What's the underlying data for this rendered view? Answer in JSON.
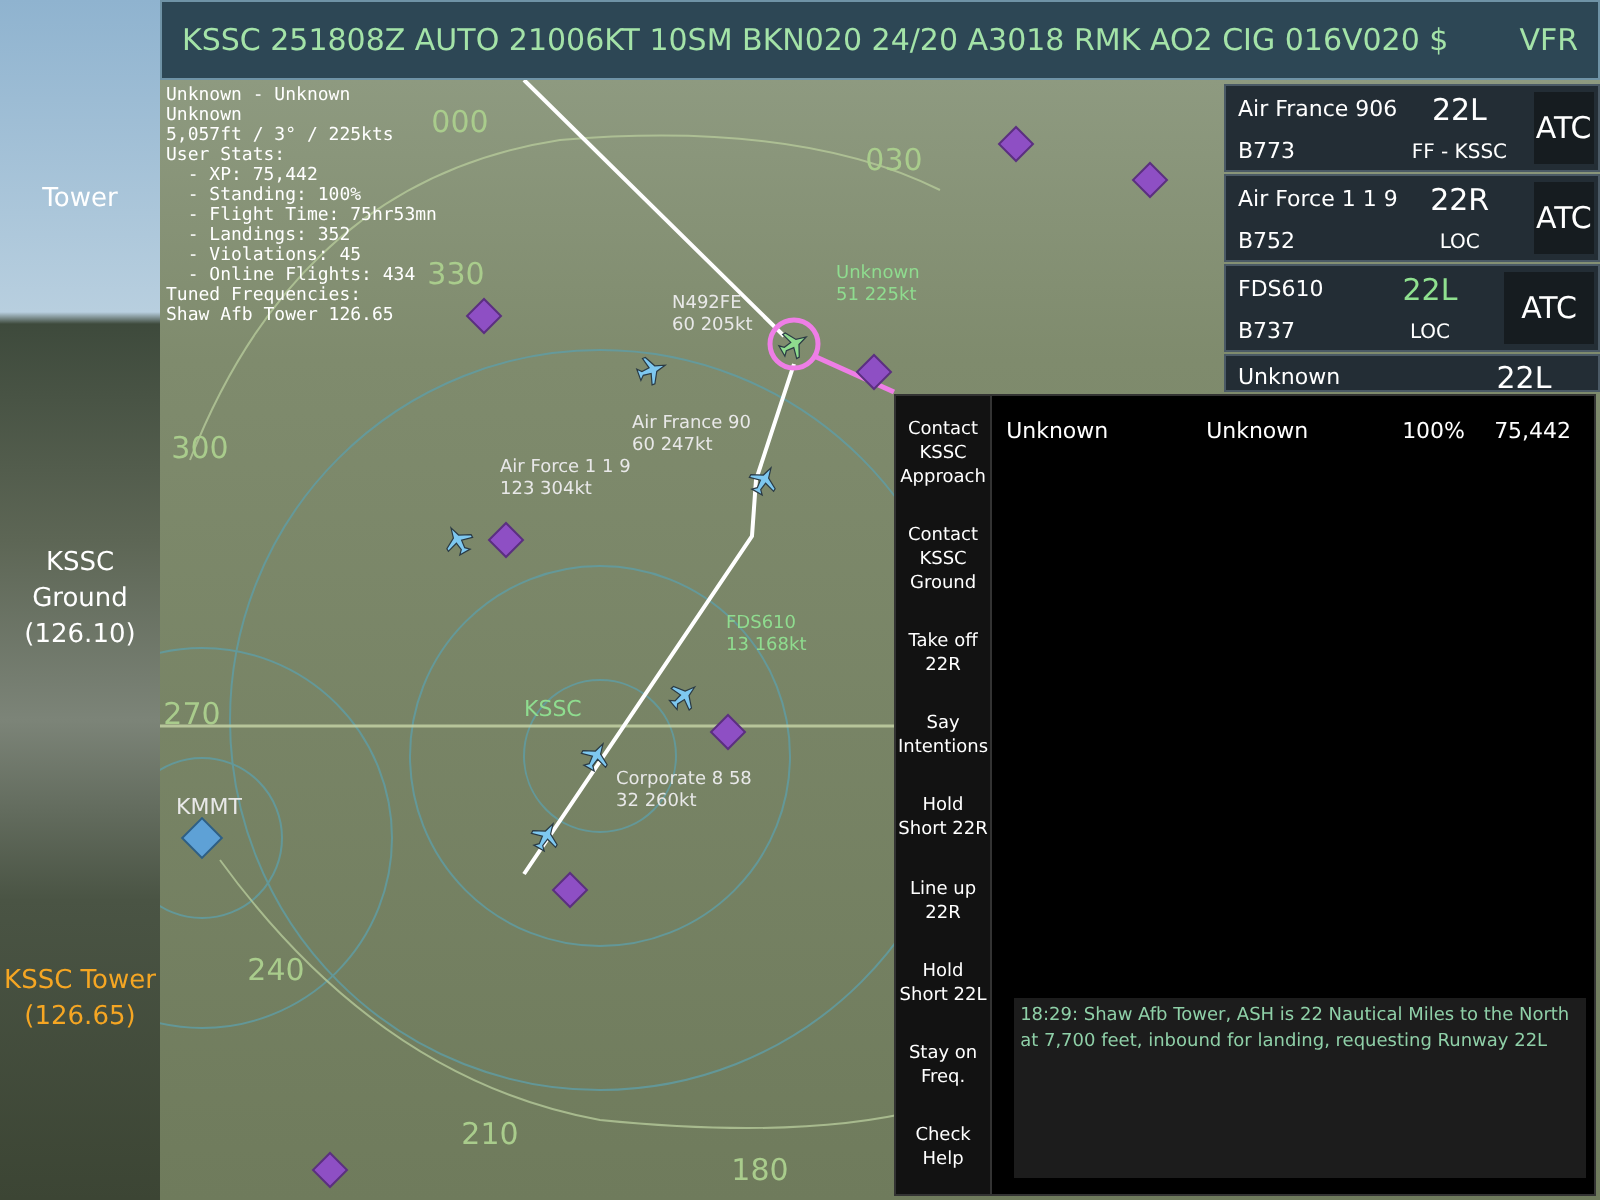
{
  "top_bar": {
    "metar": "KSSC 251808Z AUTO 21006KT 10SM BKN020 24/20 A3018 RMK AO2 CIG 016V020 $",
    "flight_rules": "VFR"
  },
  "frequencies": [
    {
      "name": "Tower",
      "selected": false
    },
    {
      "name": "KSSC Ground",
      "frequency": "(126.10)",
      "selected": false
    },
    {
      "name": "KSSC Tower",
      "frequency": "(126.65)",
      "selected": true
    }
  ],
  "stats_overlay": [
    "Unknown - Unknown",
    "Unknown",
    "5,057ft / 3° / 225kts",
    "User Stats:",
    "  - XP: 75,442",
    "  - Standing: 100%",
    "  - Flight Time: 75hr53mn",
    "  - Landings: 352",
    "  - Violations: 45",
    "  - Online Flights: 434",
    "Tuned Frequencies:",
    "Shaw Afb Tower 126.65"
  ],
  "radar": {
    "bearings": [
      "000",
      "030",
      "330",
      "300",
      "270",
      "240",
      "210",
      "180"
    ],
    "airports": [
      {
        "code": "KSSC",
        "color": "#8fdc8f"
      },
      {
        "code": "KMMT",
        "color": "#e8e8e8"
      }
    ],
    "aircraft": [
      {
        "callsign": "N492FE",
        "info": "60 205kt",
        "color": "#e8e8e8"
      },
      {
        "callsign": "Unknown",
        "info": "51 225kt",
        "color": "#8fdc8f"
      },
      {
        "callsign": "Air France 90",
        "info": "60 247kt",
        "color": "#e8e8e8"
      },
      {
        "callsign": "Air Force 1 1 9",
        "info": "123 304kt",
        "color": "#e8e8e8"
      },
      {
        "callsign": "FDS610",
        "info": "13 168kt",
        "color": "#8fdc8f"
      },
      {
        "callsign": "Corporate 8 58",
        "info": "32 260kt",
        "color": "#e8e8e8"
      }
    ]
  },
  "strips": [
    {
      "callsign": "Air France 906",
      "runway": "22L",
      "type": "B773",
      "status": "FF - KSSC",
      "color": "#ffffff",
      "button": "ATC"
    },
    {
      "callsign": "Air Force 1 1 9",
      "runway": "22R",
      "type": "B752",
      "status": "LOC",
      "color": "#ffffff",
      "button": "ATC"
    },
    {
      "callsign": "FDS610",
      "runway": "22L",
      "type": "B737",
      "status": "LOC",
      "color": "#8fe08f",
      "button": "ATC"
    },
    {
      "callsign": "Unknown",
      "runway": "22L",
      "color": "#ffffff"
    }
  ],
  "commands": [
    "Contact KSSC Approach",
    "Contact KSSC Ground",
    "Take off 22R",
    "Say Intentions",
    "Hold Short 22R",
    "Line up 22R",
    "Hold Short 22L",
    "Stay on Freq.",
    "Check Help"
  ],
  "traffic_row": [
    "Unknown",
    "Unknown",
    "100%",
    "75,442"
  ],
  "message": "18:29: Shaw Afb Tower, ASH is 22 Nautical Miles to the North at 7,700 feet, inbound for landing, requesting Runway 22L"
}
